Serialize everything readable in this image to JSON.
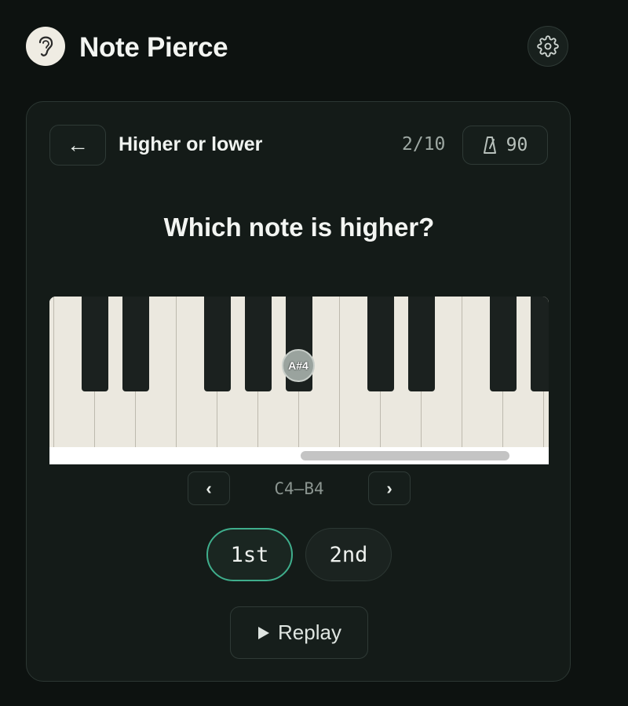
{
  "header": {
    "app_title": "Note Pierce",
    "logo_icon": "ear-icon",
    "settings_icon": "gear-icon"
  },
  "exercise": {
    "back_label": "←",
    "title": "Higher or lower",
    "progress": "2/10",
    "tempo_icon": "metronome-icon",
    "tempo": "90",
    "question": "Which note is higher?"
  },
  "piano": {
    "highlighted_note": "A#4",
    "octave_prev_label": "‹",
    "octave_next_label": "›",
    "octave_range": "C4–B4"
  },
  "answers": {
    "first_label": "1st",
    "second_label": "2nd",
    "selected": "1st"
  },
  "replay": {
    "icon": "play-icon",
    "label": "Replay"
  },
  "colors": {
    "background": "#0d1210",
    "card": "#141b18",
    "accent": "#3fae8c",
    "white_key": "#ebe8df",
    "black_key": "#1b211f"
  }
}
